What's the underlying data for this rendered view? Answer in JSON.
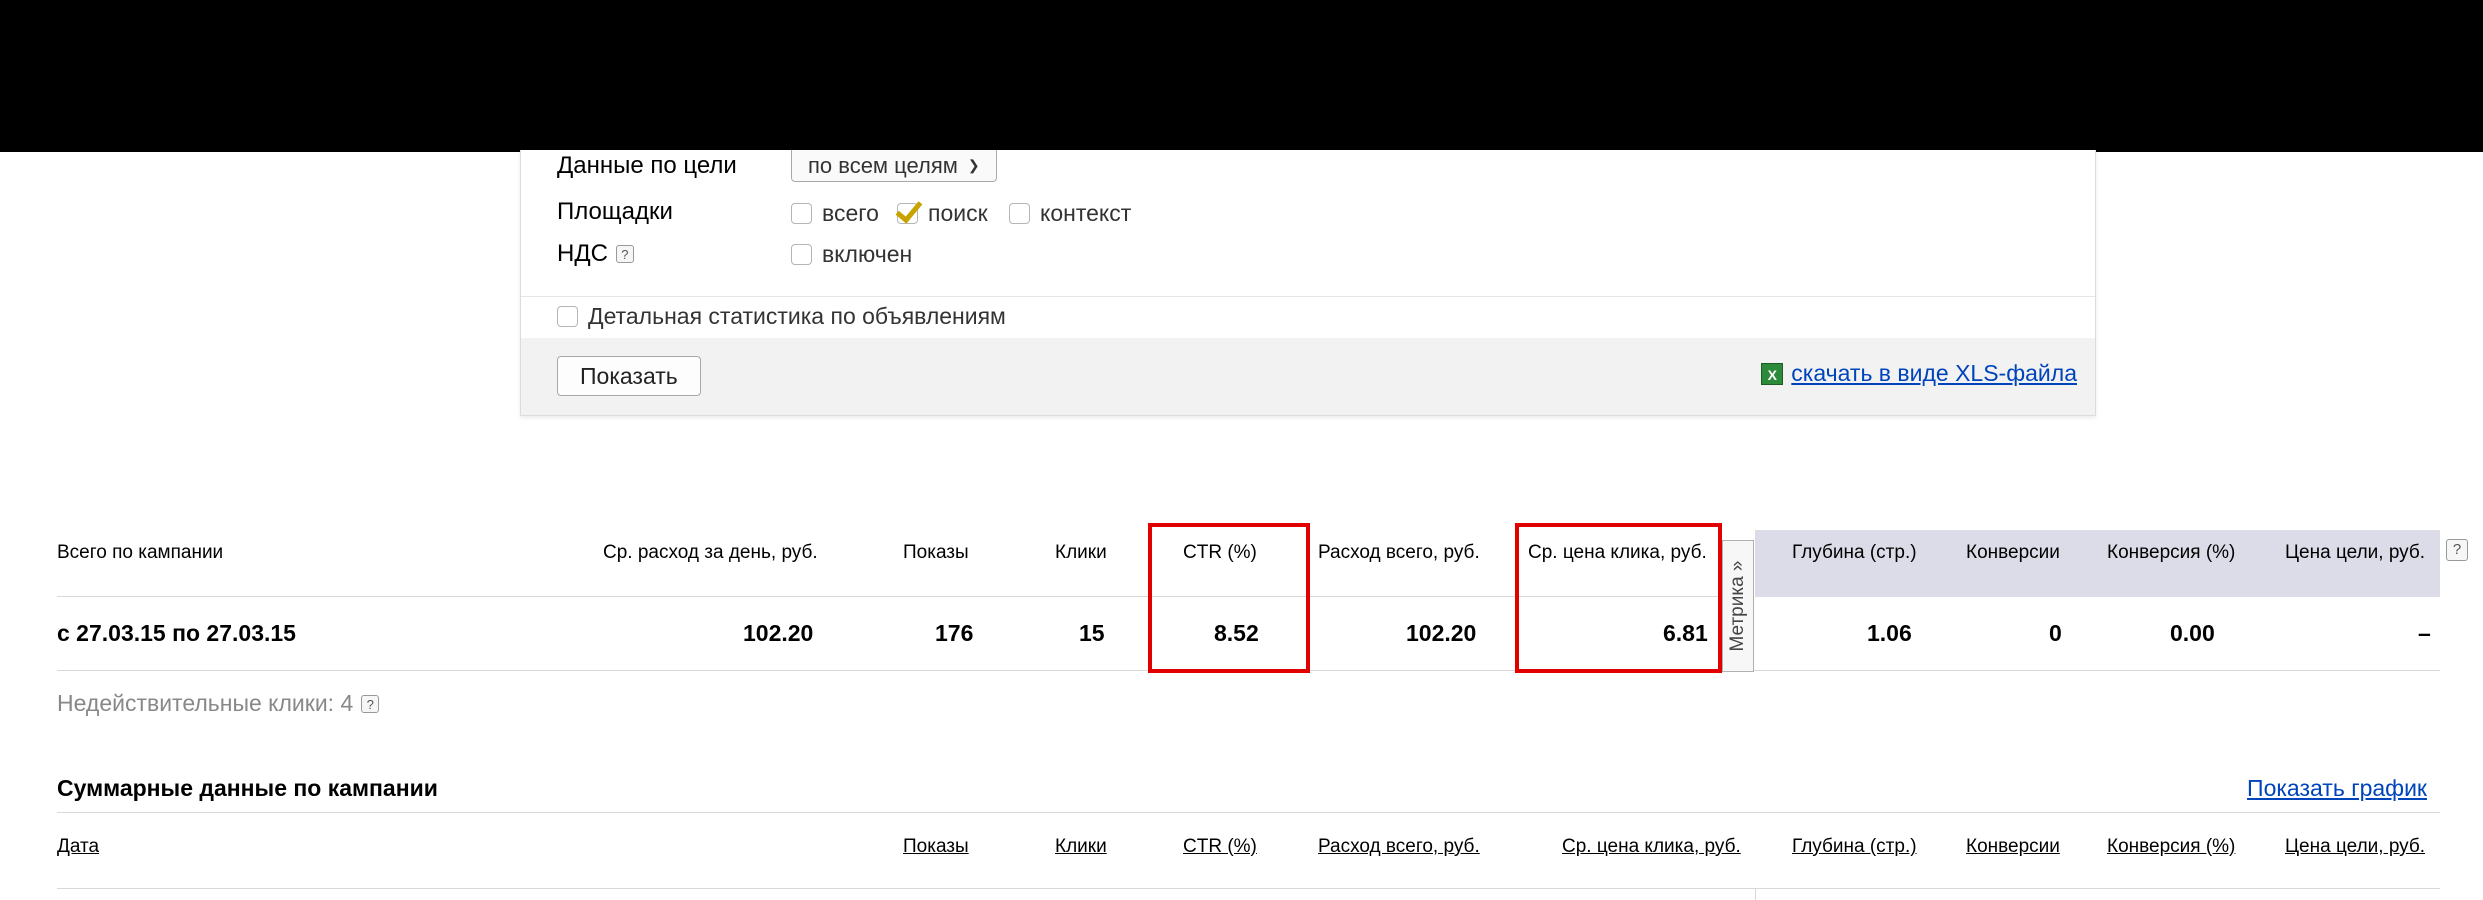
{
  "filters": {
    "goal_label": "Данные по цели",
    "goal_value": "по всем целям",
    "platforms_label": "Площадки",
    "platforms": [
      {
        "label": "всего",
        "checked": false
      },
      {
        "label": "поиск",
        "checked": true
      },
      {
        "label": "контекст",
        "checked": false
      }
    ],
    "vat_label": "НДС",
    "vat_option": "включен",
    "detailed_label": "Детальная статистика по объявлениям",
    "show_button": "Показать",
    "xls_link": "скачать в виде XLS-файла",
    "help_glyph": "?"
  },
  "stats": {
    "headers": {
      "period": "Всего по кампании",
      "avg_daily": "Ср. расход за день, руб.",
      "impressions": "Показы",
      "clicks": "Клики",
      "ctr": "CTR (%)",
      "total_cost": "Расход всего, руб.",
      "avg_cpc": "Ср. цена клика, руб.",
      "depth": "Глубина (стр.)",
      "conversions": "Конверсии",
      "conversion_rate": "Конверсия (%)",
      "goal_price": "Цена цели, руб."
    },
    "metrika_tab": "Метрика »",
    "row": {
      "period": "с 27.03.15 по 27.03.15",
      "avg_daily": "102.20",
      "impressions": "176",
      "clicks": "15",
      "ctr": "8.52",
      "total_cost": "102.20",
      "avg_cpc": "6.81",
      "depth": "1.06",
      "conversions": "0",
      "conversion_rate": "0.00",
      "goal_price": "–"
    },
    "invalid_clicks": "Недействительные клики: 4"
  },
  "summary": {
    "title": "Суммарные данные по кампании",
    "graph_link": "Показать график",
    "headers": {
      "date": "Дата",
      "impressions": "Показы",
      "clicks": "Клики",
      "ctr": "CTR (%)",
      "total_cost": "Расход всего, руб.",
      "avg_cpc": "Ср. цена клика, руб.",
      "depth": "Глубина (стр.)",
      "conversions": "Конверсии",
      "conversion_rate": "Конверсия (%)",
      "goal_price": "Цена цели, руб."
    }
  },
  "colors": {
    "highlight": "#e00000",
    "link": "#0044bb",
    "metrika_shade": "#dcdce8"
  }
}
